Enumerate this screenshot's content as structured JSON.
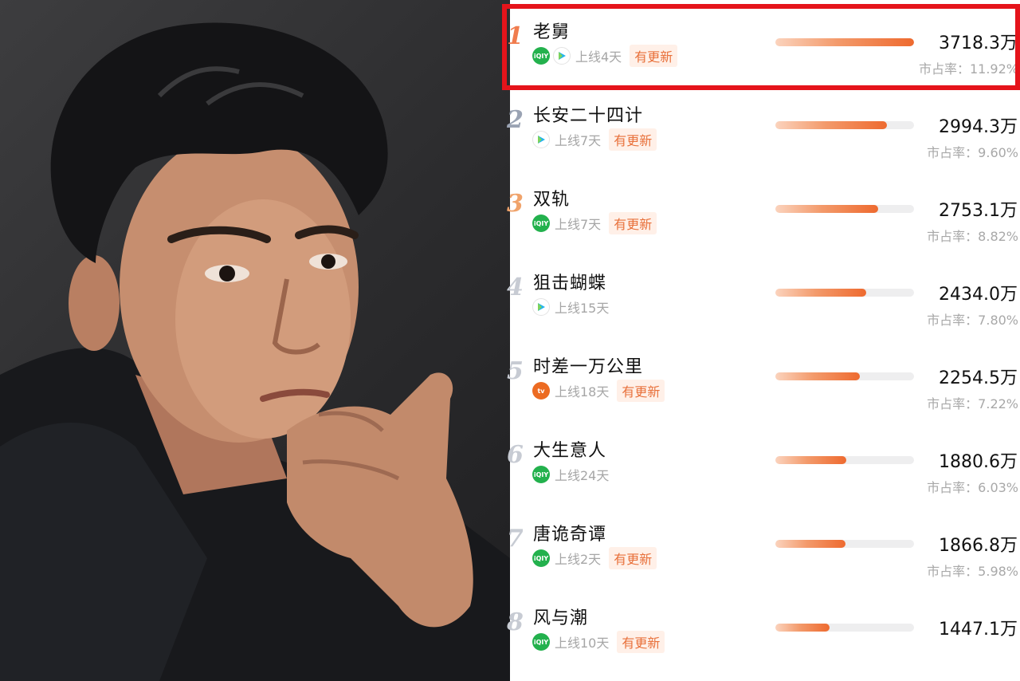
{
  "ranking": {
    "items": [
      {
        "rank": "1",
        "title": "老舅",
        "platforms": [
          "iqiyi",
          "tencent"
        ],
        "online": "上线4天",
        "badge": "有更新",
        "value": "3718.3万",
        "share_label": "市占率：",
        "share": "11.92%",
        "share_pct": 100
      },
      {
        "rank": "2",
        "title": "长安二十四计",
        "platforms": [
          "tencent"
        ],
        "online": "上线7天",
        "badge": "有更新",
        "value": "2994.3万",
        "share_label": "市占率：",
        "share": "9.60%",
        "share_pct": 80.5
      },
      {
        "rank": "3",
        "title": "双轨",
        "platforms": [
          "iqiyi"
        ],
        "online": "上线7天",
        "badge": "有更新",
        "value": "2753.1万",
        "share_label": "市占率：",
        "share": "8.82%",
        "share_pct": 74
      },
      {
        "rank": "4",
        "title": "狙击蝴蝶",
        "platforms": [
          "tencent"
        ],
        "online": "上线15天",
        "badge": "",
        "value": "2434.0万",
        "share_label": "市占率：",
        "share": "7.80%",
        "share_pct": 65.5
      },
      {
        "rank": "5",
        "title": "时差一万公里",
        "platforms": [
          "mango"
        ],
        "online": "上线18天",
        "badge": "有更新",
        "value": "2254.5万",
        "share_label": "市占率：",
        "share": "7.22%",
        "share_pct": 61
      },
      {
        "rank": "6",
        "title": "大生意人",
        "platforms": [
          "iqiyi"
        ],
        "online": "上线24天",
        "badge": "",
        "value": "1880.6万",
        "share_label": "市占率：",
        "share": "6.03%",
        "share_pct": 51
      },
      {
        "rank": "7",
        "title": "唐诡奇谭",
        "platforms": [
          "iqiyi"
        ],
        "online": "上线2天",
        "badge": "有更新",
        "value": "1866.8万",
        "share_label": "市占率：",
        "share": "5.98%",
        "share_pct": 50.5
      },
      {
        "rank": "8",
        "title": "风与潮",
        "platforms": [
          "iqiyi"
        ],
        "online": "上线10天",
        "badge": "有更新",
        "value": "1447.1万",
        "share_label": "",
        "share": "",
        "share_pct": 39
      }
    ]
  },
  "platform_icons": {
    "iqiyi": {
      "name": "iqiyi-icon",
      "color": "#23b14d",
      "glyph": "iQIY"
    },
    "tencent": {
      "name": "tencent-video-icon",
      "color": "#1fb3f0",
      "glyph": ""
    },
    "mango": {
      "name": "mango-tv-icon",
      "color": "#ec6b22",
      "glyph": "tv"
    }
  },
  "colors": {
    "accent": "#ee6a2f",
    "highlight_border": "#e5141b"
  }
}
